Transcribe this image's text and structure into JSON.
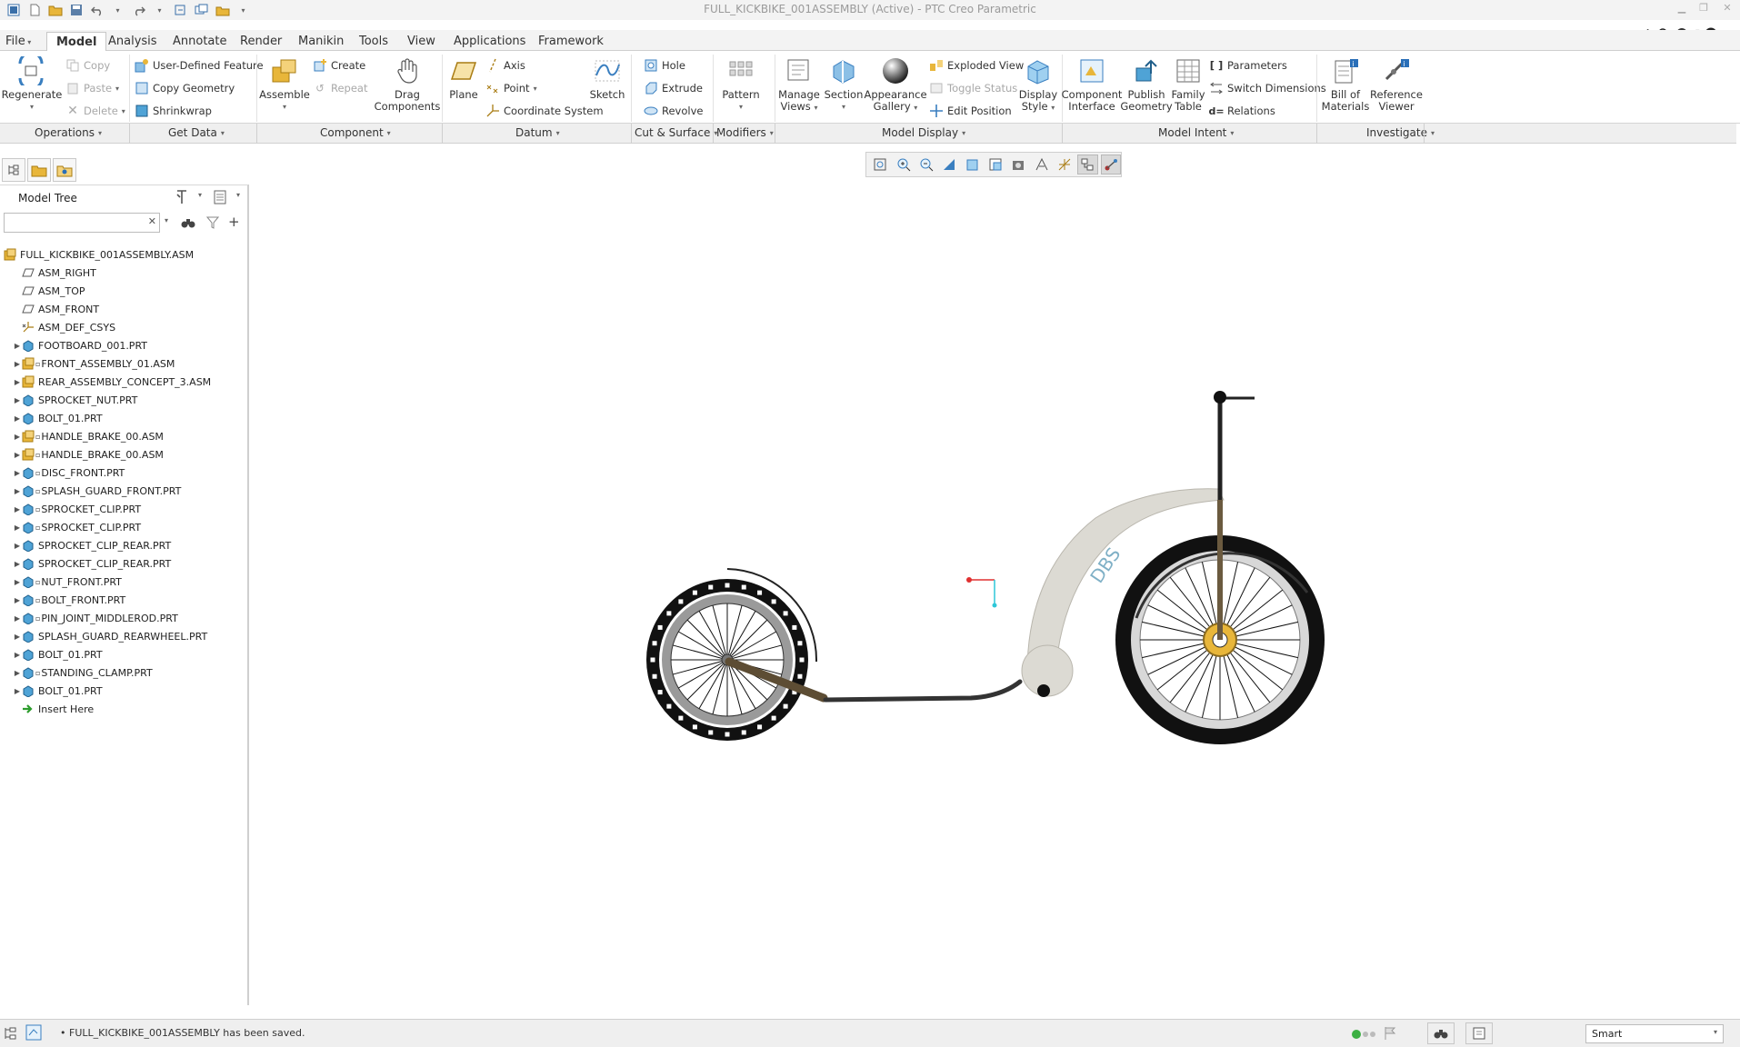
{
  "window": {
    "title": "FULL_KICKBIKE_001ASSEMBLY (Active) - PTC Creo Parametric"
  },
  "tabs": [
    {
      "label": "File"
    },
    {
      "label": "Model"
    },
    {
      "label": "Analysis"
    },
    {
      "label": "Annotate"
    },
    {
      "label": "Render"
    },
    {
      "label": "Manikin"
    },
    {
      "label": "Tools"
    },
    {
      "label": "View"
    },
    {
      "label": "Applications"
    },
    {
      "label": "Framework"
    }
  ],
  "ribbon": {
    "regenerate": "Regenerate",
    "copy": "Copy",
    "paste": "Paste",
    "delete": "Delete",
    "udf": "User-Defined Feature",
    "copy_geometry": "Copy Geometry",
    "shrinkwrap": "Shrinkwrap",
    "assemble": "Assemble",
    "create": "Create",
    "repeat": "Repeat",
    "drag_components_1": "Drag",
    "drag_components_2": "Components",
    "plane": "Plane",
    "axis": "Axis",
    "point": "Point",
    "csys": "Coordinate System",
    "sketch": "Sketch",
    "hole": "Hole",
    "extrude": "Extrude",
    "revolve": "Revolve",
    "pattern": "Pattern",
    "manage_views_1": "Manage",
    "manage_views_2": "Views",
    "section": "Section",
    "appearance_1": "Appearance",
    "appearance_2": "Gallery",
    "exploded_view": "Exploded View",
    "toggle_status": "Toggle Status",
    "edit_position": "Edit Position",
    "display_style_1": "Display",
    "display_style_2": "Style",
    "component_interface_1": "Component",
    "component_interface_2": "Interface",
    "publish_geometry_1": "Publish",
    "publish_geometry_2": "Geometry",
    "family_table_1": "Family",
    "family_table_2": "Table",
    "parameters": "Parameters",
    "switch_dimensions": "Switch Dimensions",
    "relations": "Relations",
    "bom_1": "Bill of",
    "bom_2": "Materials",
    "reference_viewer_1": "Reference",
    "reference_viewer_2": "Viewer"
  },
  "groups": {
    "operations": "Operations",
    "get_data": "Get Data",
    "component": "Component",
    "datum": "Datum",
    "cut_surface": "Cut & Surface",
    "modifiers": "Modifiers",
    "model_display": "Model Display",
    "model_intent": "Model Intent",
    "investigate": "Investigate"
  },
  "model_tree": {
    "title": "Model Tree",
    "search_value": "",
    "items": [
      {
        "label": "FULL_KICKBIKE_001ASSEMBLY.ASM",
        "type": "asm",
        "expandable": false,
        "indent": 0
      },
      {
        "label": "ASM_RIGHT",
        "type": "plane",
        "expandable": false,
        "indent": 1
      },
      {
        "label": "ASM_TOP",
        "type": "plane",
        "expandable": false,
        "indent": 1
      },
      {
        "label": "ASM_FRONT",
        "type": "plane",
        "expandable": false,
        "indent": 1
      },
      {
        "label": "ASM_DEF_CSYS",
        "type": "csys",
        "expandable": false,
        "indent": 1
      },
      {
        "label": "FOOTBOARD_001.PRT",
        "type": "part",
        "expandable": true,
        "indent": 1
      },
      {
        "label": "FRONT_ASSEMBLY_01.ASM",
        "type": "asm-sub",
        "expandable": true,
        "indent": 1
      },
      {
        "label": "REAR_ASSEMBLY_CONCEPT_3.ASM",
        "type": "asm",
        "expandable": true,
        "indent": 1
      },
      {
        "label": "SPROCKET_NUT.PRT",
        "type": "part",
        "expandable": true,
        "indent": 1
      },
      {
        "label": "BOLT_01.PRT",
        "type": "part",
        "expandable": true,
        "indent": 1
      },
      {
        "label": "HANDLE_BRAKE_00.ASM",
        "type": "asm-link",
        "expandable": true,
        "indent": 1
      },
      {
        "label": "HANDLE_BRAKE_00.ASM",
        "type": "asm-link",
        "expandable": true,
        "indent": 1
      },
      {
        "label": "DISC_FRONT.PRT",
        "type": "part-link",
        "expandable": true,
        "indent": 1
      },
      {
        "label": "SPLASH_GUARD_FRONT.PRT",
        "type": "part-link",
        "expandable": true,
        "indent": 1
      },
      {
        "label": "SPROCKET_CLIP.PRT",
        "type": "part-link",
        "expandable": true,
        "indent": 1
      },
      {
        "label": "SPROCKET_CLIP.PRT",
        "type": "part-link",
        "expandable": true,
        "indent": 1
      },
      {
        "label": "SPROCKET_CLIP_REAR.PRT",
        "type": "part",
        "expandable": true,
        "indent": 1
      },
      {
        "label": "SPROCKET_CLIP_REAR.PRT",
        "type": "part",
        "expandable": true,
        "indent": 1
      },
      {
        "label": "NUT_FRONT.PRT",
        "type": "part-link",
        "expandable": true,
        "indent": 1
      },
      {
        "label": "BOLT_FRONT.PRT",
        "type": "part-link",
        "expandable": true,
        "indent": 1
      },
      {
        "label": "PIN_JOINT_MIDDLEROD.PRT",
        "type": "part-link",
        "expandable": true,
        "indent": 1
      },
      {
        "label": "SPLASH_GUARD_REARWHEEL.PRT",
        "type": "part",
        "expandable": true,
        "indent": 1
      },
      {
        "label": "BOLT_01.PRT",
        "type": "part",
        "expandable": true,
        "indent": 1
      },
      {
        "label": "STANDING_CLAMP.PRT",
        "type": "part-sub",
        "expandable": true,
        "indent": 1
      },
      {
        "label": "BOLT_01.PRT",
        "type": "part",
        "expandable": true,
        "indent": 1
      },
      {
        "label": "Insert Here",
        "type": "insert",
        "expandable": false,
        "indent": 1
      }
    ]
  },
  "graphics": {
    "logo_text": "DBS"
  },
  "status": {
    "message": "FULL_KICKBIKE_001ASSEMBLY has been saved.",
    "filter": "Smart"
  },
  "colors": {
    "accent": "#2a6fb8",
    "folder": "#e8b63a",
    "part": "#4fa3d6",
    "frame": "#d4d3cd",
    "tire": "#111111",
    "fork": "#6b5a3f"
  }
}
